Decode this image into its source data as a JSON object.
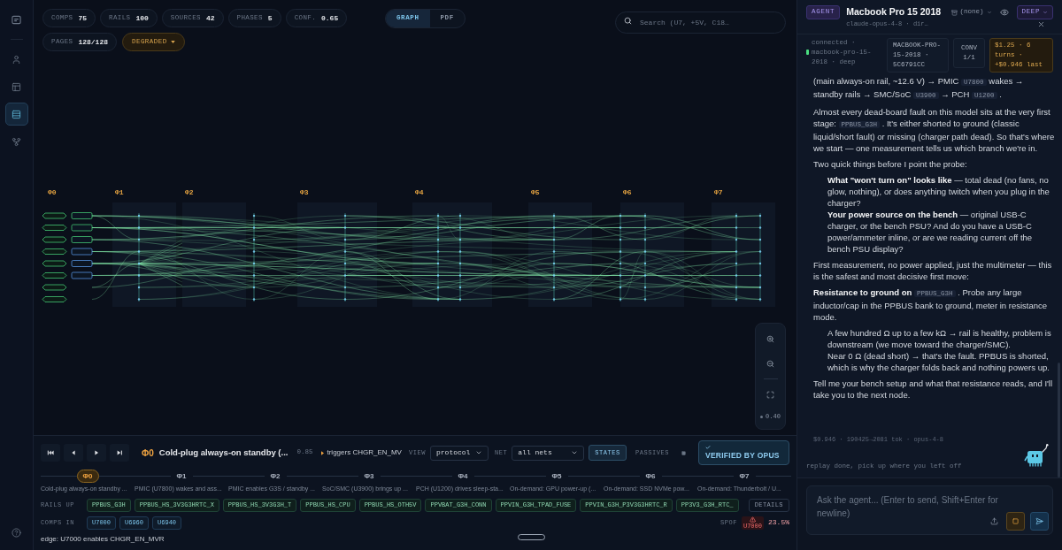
{
  "nav_rail": {
    "items": [
      {
        "selected": false
      },
      {
        "selected": false
      },
      {
        "selected": false
      },
      {
        "selected": true
      },
      {
        "selected": false
      }
    ]
  },
  "stats": [
    {
      "label": "COMPS",
      "value": "75"
    },
    {
      "label": "RAILS",
      "value": "100"
    },
    {
      "label": "SOURCES",
      "value": "42"
    },
    {
      "label": "PHASES",
      "value": "5"
    },
    {
      "label": "CONF.",
      "value": "0.65"
    }
  ],
  "pages": {
    "label": "PAGES",
    "value": "128/128"
  },
  "health": {
    "label": "DEGRADED"
  },
  "view_tabs": [
    {
      "label": "GRAPH",
      "selected": true
    },
    {
      "label": "PDF",
      "selected": false
    }
  ],
  "search": {
    "placeholder": "Search (U7, +5V, C18…"
  },
  "graph": {
    "columns": [
      "Φ0",
      "Φ1",
      "Φ2",
      "Φ3",
      "Φ4",
      "Φ5",
      "Φ6",
      "Φ7"
    ]
  },
  "zoom": {
    "reading": "0.40"
  },
  "player": {
    "phase": "Φ0",
    "title": "Cold-plug always-on standby (...",
    "score": "0.85",
    "trigger": "triggers CHGR_EN_MV"
  },
  "view_select": {
    "label": "VIEW",
    "value": "protocol"
  },
  "net_select": {
    "label": "NET",
    "value": "all nets"
  },
  "toggles": [
    {
      "label": "STATES",
      "on": true
    },
    {
      "label": "PASSIVES",
      "on": false
    }
  ],
  "verified": {
    "label": "VERIFIED BY OPUS"
  },
  "phases": [
    {
      "id": "Φ0",
      "caption": "Cold-plug always-on standby ...",
      "selected": true
    },
    {
      "id": "Φ1",
      "caption": "PMIC (U7800) wakes and ass...",
      "selected": false
    },
    {
      "id": "Φ2",
      "caption": "PMIC enables G3S / standby ...",
      "selected": false
    },
    {
      "id": "Φ3",
      "caption": "SoC/SMC (U3900) brings up ...",
      "selected": false
    },
    {
      "id": "Φ4",
      "caption": "PCH (U1200) drives sleep-sta...",
      "selected": false
    },
    {
      "id": "Φ5",
      "caption": "On-demand: GPU power-up (...",
      "selected": false
    },
    {
      "id": "Φ6",
      "caption": "On-demand: SSD NVMe pow...",
      "selected": false
    },
    {
      "id": "Φ7",
      "caption": "On-demand: Thunderbolt / U...",
      "selected": false
    }
  ],
  "rails_up": {
    "label": "RAILS UP",
    "items": [
      "PPBUS_G3H",
      "PPBUS_HS_3V3G3HRTC_X",
      "PPBUS_HS_3V3G3H_T",
      "PPBUS_HS_CPU",
      "PPBUS_HS_OTH5V",
      "PPVBAT_G3H_CONN",
      "PPVIN_G3H_TPAD_FUSE",
      "PPVIN_G3H_P3V3G3HRTC_R",
      "PP3V3_G3H_RTC_"
    ],
    "action": "DETAILS"
  },
  "comps_in": {
    "label": "COMPS IN",
    "items": [
      "U7000",
      "U6960",
      "U6940"
    ]
  },
  "spof": {
    "label": "SPOF",
    "component": "U7000",
    "share": "23.5%"
  },
  "edge": "edge: U7000 enables CHGR_EN_MVR",
  "agent": {
    "badge": "AGENT",
    "title": "Macbook Pro 15 2018",
    "subtitle": "claude-opus-4-8 · dir…",
    "context": "(none)",
    "mode": "DEEP",
    "connection": "connected · macbook-pro-15-2018 · deep",
    "device": "MACBOOK-PRO-15-2018 · 5C6791CC",
    "conversation": {
      "label": "CONV",
      "value": "1/1"
    },
    "cost": "$1.25 · 6 turns · +$0.946 last",
    "message": [
      {
        "kind": "paragraph",
        "segments": [
          {
            "kind": "text",
            "text": "(main always-on rail, ~12.6 V) → PMIC "
          },
          {
            "kind": "code",
            "text": "U7800"
          },
          {
            "kind": "text",
            "text": " wakes → standby rails → SMC/SoC "
          },
          {
            "kind": "code",
            "text": "U3900"
          },
          {
            "kind": "text",
            "text": " → PCH "
          },
          {
            "kind": "code",
            "text": "U1200"
          },
          {
            "kind": "text",
            "text": " ."
          }
        ]
      },
      {
        "kind": "paragraph",
        "segments": [
          {
            "kind": "text",
            "text": "Almost every dead-board fault on this model sits at the very first stage: "
          },
          {
            "kind": "code",
            "text": "PPBUS_G3H"
          },
          {
            "kind": "text",
            "text": " . It's either shorted to ground (classic liquid/short fault) or missing (charger path dead). So that's where we start — one measurement tells us which branch we're in."
          }
        ]
      },
      {
        "kind": "paragraph",
        "segments": [
          {
            "kind": "text",
            "text": "Two quick things before I point the probe:"
          }
        ]
      },
      {
        "kind": "list",
        "items": [
          [
            {
              "kind": "bold",
              "text": "What \"won't turn on\" looks like"
            },
            {
              "kind": "text",
              "text": " — total dead (no fans, no glow, nothing), or does anything twitch when you plug in the charger?"
            }
          ],
          [
            {
              "kind": "bold",
              "text": "Your power source on the bench"
            },
            {
              "kind": "text",
              "text": " — original USB-C charger, or the bench PSU? And do you have a USB-C power/ammeter inline, or are we reading current off the bench PSU display?"
            }
          ]
        ]
      },
      {
        "kind": "paragraph",
        "segments": [
          {
            "kind": "text",
            "text": "First measurement, no power applied, just the multimeter — this is the safest and most decisive first move:"
          }
        ]
      },
      {
        "kind": "paragraph",
        "segments": [
          {
            "kind": "bold",
            "text": "Resistance to ground on "
          },
          {
            "kind": "code",
            "text": "PPBUS_G3H"
          },
          {
            "kind": "text",
            "text": " . Probe any large inductor/cap in the PPBUS bank to ground, meter in resistance mode."
          }
        ]
      },
      {
        "kind": "list",
        "items": [
          [
            {
              "kind": "text",
              "text": "A few hundred Ω up to a few kΩ → rail is healthy, problem is downstream (we move toward the charger/SMC)."
            }
          ],
          [
            {
              "kind": "text",
              "text": "Near 0 Ω (dead short) → that's the fault. PPBUS is shorted, which is why the charger folds back and nothing powers up."
            }
          ]
        ]
      },
      {
        "kind": "paragraph",
        "segments": [
          {
            "kind": "text",
            "text": "Tell me your bench setup and what that resistance reads, and I'll take you to the next node."
          }
        ]
      }
    ],
    "meta": "$0.946 · 190425→2081 tok · opus-4-8",
    "replay": "replay done, pick up where you left off",
    "composer": {
      "placeholder": "Ask the agent... (Enter to send, Shift+Enter for newline)"
    }
  }
}
